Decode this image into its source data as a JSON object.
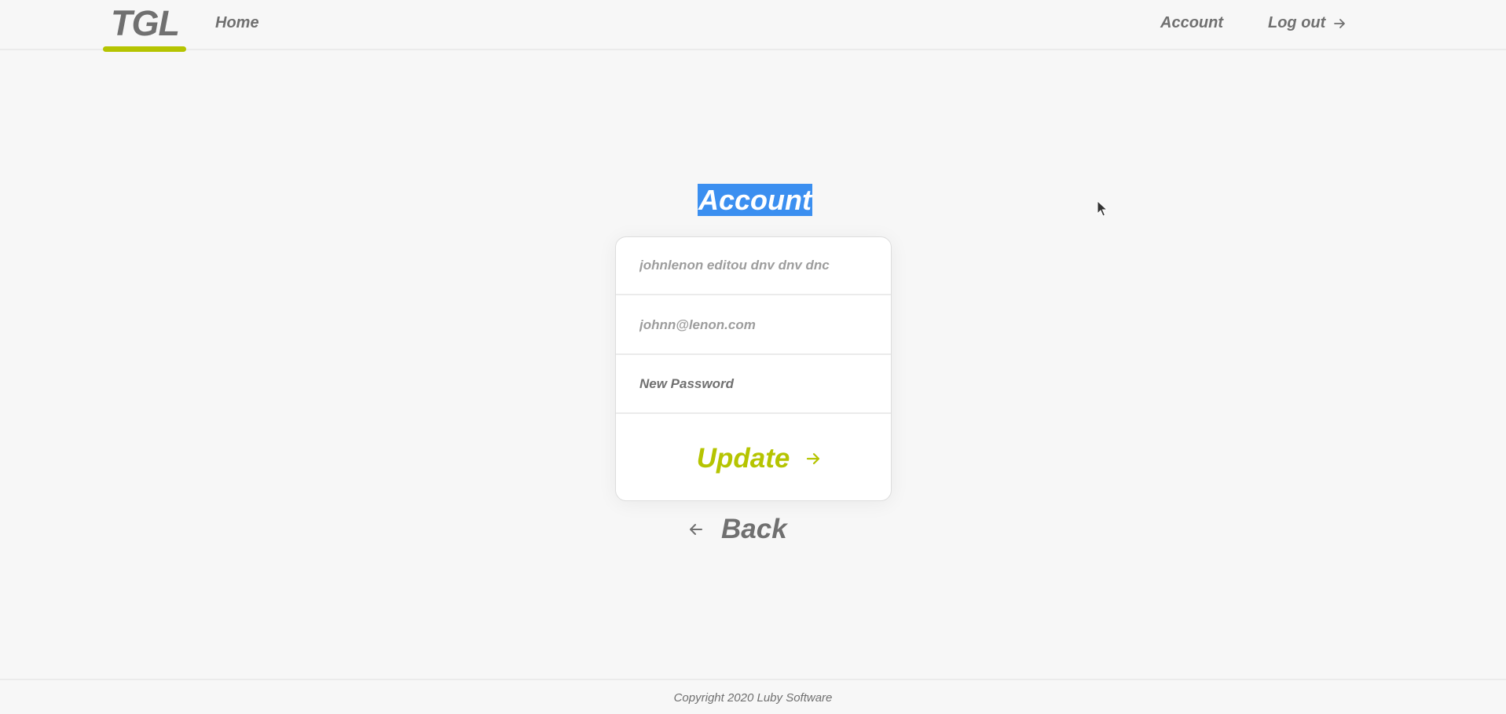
{
  "header": {
    "logo": "TGL",
    "nav": {
      "home": "Home",
      "account": "Account",
      "logout": "Log out"
    }
  },
  "main": {
    "title": "Account",
    "form": {
      "name_value": "johnlenon editou dnv dnv dnc",
      "email_value": "johnn@lenon.com",
      "password_placeholder": "New Password",
      "update_label": "Update"
    },
    "back_label": "Back"
  },
  "footer": {
    "copyright": "Copyright 2020 Luby Software"
  },
  "colors": {
    "accent": "#b5c401",
    "text_gray": "#707070",
    "selection": "#3b8ff0",
    "background": "#f7f7f7"
  },
  "icons": {
    "logout": "arrow-right-icon",
    "update": "arrow-right-icon",
    "back": "arrow-left-icon"
  }
}
